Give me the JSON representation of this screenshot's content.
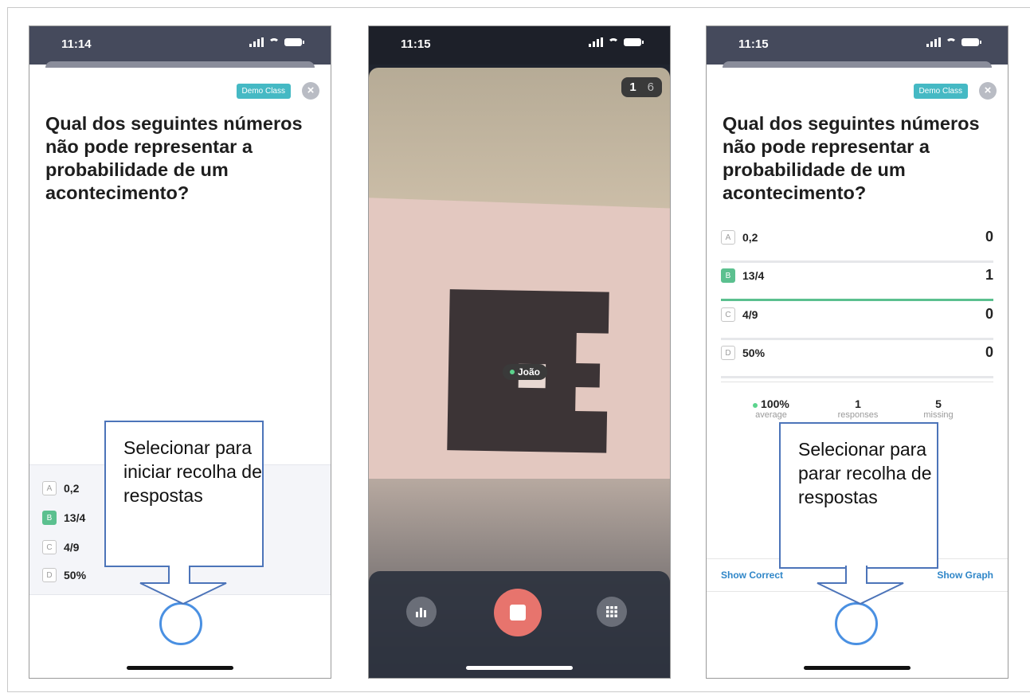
{
  "screens": [
    {
      "time": "11:14",
      "tag": "Demo Class",
      "close_icon": "×",
      "question": "Qual dos seguintes números não pode representar a probabilidade de um acontecimento?",
      "options": [
        {
          "letter": "A",
          "text": "0,2",
          "correct": false
        },
        {
          "letter": "B",
          "text": "13/4",
          "correct": true
        },
        {
          "letter": "C",
          "text": "4/9",
          "correct": false
        },
        {
          "letter": "D",
          "text": "50%",
          "correct": false
        }
      ],
      "callout": "Selecionar para iniciar recolha de respostas"
    },
    {
      "time": "11:15",
      "counter": {
        "answered": "1",
        "total": "6"
      },
      "student_label": "João",
      "controls": [
        "chart-icon",
        "stop-button",
        "grid-icon"
      ]
    },
    {
      "time": "11:15",
      "tag": "Demo Class",
      "close_icon": "×",
      "question": "Qual dos seguintes números não pode representar a probabilidade de um acontecimento?",
      "results": [
        {
          "letter": "A",
          "text": "0,2",
          "count": "0",
          "correct": false
        },
        {
          "letter": "B",
          "text": "13/4",
          "count": "1",
          "correct": true
        },
        {
          "letter": "C",
          "text": "4/9",
          "count": "0",
          "correct": false
        },
        {
          "letter": "D",
          "text": "50%",
          "count": "0",
          "correct": false
        }
      ],
      "stats": [
        {
          "value": "100%",
          "label": "average"
        },
        {
          "value": "1",
          "label": "responses"
        },
        {
          "value": "5",
          "label": "missing"
        }
      ],
      "show_correct": "Show Correct",
      "show_graph": "Show Graph",
      "callout": "Selecionar para parar recolha de respostas"
    }
  ],
  "colors": {
    "accent_green": "#5bc08f",
    "tag": "#45b9c4",
    "callout_border": "#4c74b9",
    "stop": "#e7746d",
    "link": "#2f86c8"
  }
}
